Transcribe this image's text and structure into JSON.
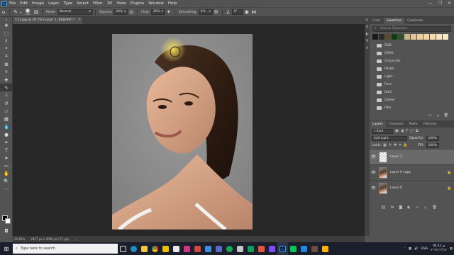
{
  "app": {
    "logo_text": "Ps",
    "menus": [
      "File",
      "Edit",
      "Image",
      "Layer",
      "Type",
      "Select",
      "Filter",
      "3D",
      "View",
      "Plugins",
      "Window",
      "Help"
    ],
    "window_controls": [
      "—",
      "❐",
      "✕"
    ]
  },
  "options": {
    "brush_size": "200",
    "mode_label": "Mode:",
    "mode_value": "Normal",
    "opacity_label": "Opacity:",
    "opacity_value": "20%",
    "flow_label": "Flow:",
    "flow_value": "20%",
    "smoothing_label": "Smoothing:",
    "smoothing_value": "0%",
    "angle_value": "0°"
  },
  "document": {
    "tab_title": "111.jpg @ 20.7% (Layer 1, RGB/8#) *",
    "close_glyph": "✕"
  },
  "status": {
    "zoom": "20.66%",
    "dimensions": "2857 px x 4000 px (72 ppi)",
    "arrow": "›"
  },
  "swatches": {
    "tabs": [
      "Color",
      "Swatches",
      "Gradients"
    ],
    "active_tab": "Swatches",
    "search_placeholder": "Search Swatches",
    "recent_colors": [
      "#1a1a1a",
      "#2b2b2b",
      "#5a4a2e",
      "#123d12",
      "#2d4f2d",
      "#c9b487",
      "#e2c79b",
      "#f0cf96",
      "#f3d6a2",
      "#f7dcae",
      "#fae4bd",
      "#fbe9c8"
    ],
    "groups": [
      "RGB",
      "CMYK",
      "Grayscale",
      "Pastel",
      "Light",
      "Pure",
      "Dark",
      "Darker",
      "Pale"
    ]
  },
  "layers": {
    "tabs": [
      "Layers",
      "Channels",
      "Paths",
      "Patterns"
    ],
    "active_tab": "Layers",
    "kind_label": "Kind",
    "blend_mode": "Soft Light",
    "opacity_label": "Opacity:",
    "opacity_value": "100%",
    "lock_label": "Lock:",
    "fill_label": "Fill:",
    "fill_value": "100%",
    "items": [
      {
        "name": "Layer 1",
        "selected": true
      },
      {
        "name": "Layer 0 copy",
        "selected": false
      },
      {
        "name": "Layer 0",
        "selected": false
      }
    ]
  },
  "taskbar": {
    "search_placeholder": "Type here to search",
    "language": "ENG",
    "time": "04:11 م",
    "date": "۲۰۲۱/۰۳/۱۶"
  }
}
